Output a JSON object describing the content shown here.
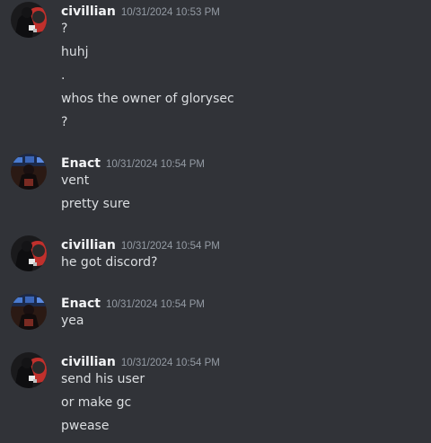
{
  "groups": [
    {
      "author": "civillian",
      "timestamp": "10/31/2024 10:53 PM",
      "avatar": "dark-figure-red-background",
      "messages": [
        "?",
        "huhj",
        ".",
        "whos the owner of glorysec",
        "?"
      ]
    },
    {
      "author": "Enact",
      "timestamp": "10/31/2024 10:54 PM",
      "avatar": "figure-screens-background",
      "messages": [
        "vent",
        "pretty sure"
      ]
    },
    {
      "author": "civillian",
      "timestamp": "10/31/2024 10:54 PM",
      "avatar": "dark-figure-red-background",
      "messages": [
        "he got discord?"
      ]
    },
    {
      "author": "Enact",
      "timestamp": "10/31/2024 10:54 PM",
      "avatar": "figure-screens-background",
      "messages": [
        "yea"
      ]
    },
    {
      "author": "civillian",
      "timestamp": "10/31/2024 10:54 PM",
      "avatar": "dark-figure-red-background",
      "messages": [
        "send his user",
        "or make gc",
        "pwease"
      ]
    }
  ],
  "colors": {
    "background": "#313338",
    "username": "#f2f3f5",
    "timestamp": "#949ba4",
    "message_text": "#dbdee1"
  }
}
